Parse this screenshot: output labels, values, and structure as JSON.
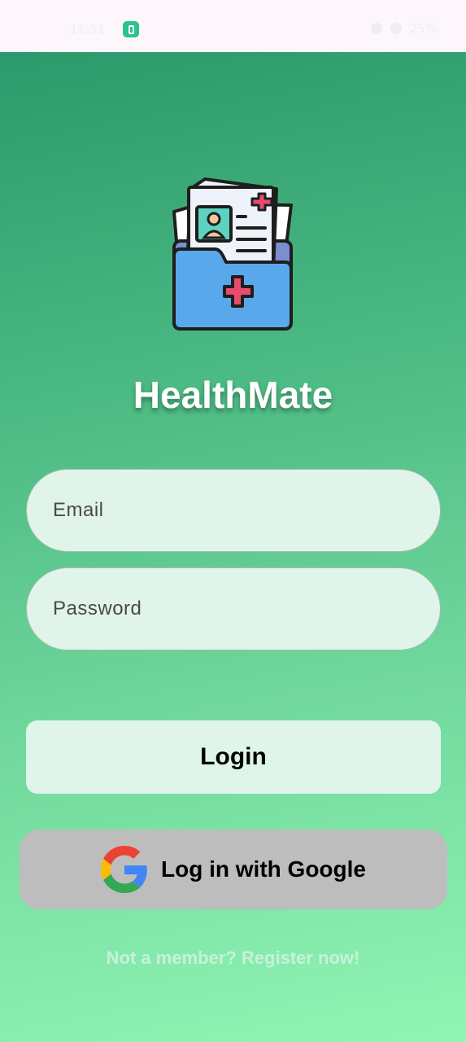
{
  "status_bar": {
    "time": "11:51",
    "battery_percent": "25%"
  },
  "app": {
    "title": "HealthMate",
    "logo_icon": "medical-records-folder-icon"
  },
  "form": {
    "email_placeholder": "Email",
    "password_placeholder": "Password"
  },
  "buttons": {
    "login_label": "Login",
    "google_label": "Log in with Google",
    "google_icon": "google-logo-icon"
  },
  "register": {
    "text": "Not a member? Register now!"
  },
  "colors": {
    "gradient_top": "#2b9a6c",
    "gradient_bottom": "#90f5b4",
    "field_bg": "#e0f4e9",
    "google_button_bg": "#bdbdbd",
    "register_text": "#c8f1d9"
  }
}
